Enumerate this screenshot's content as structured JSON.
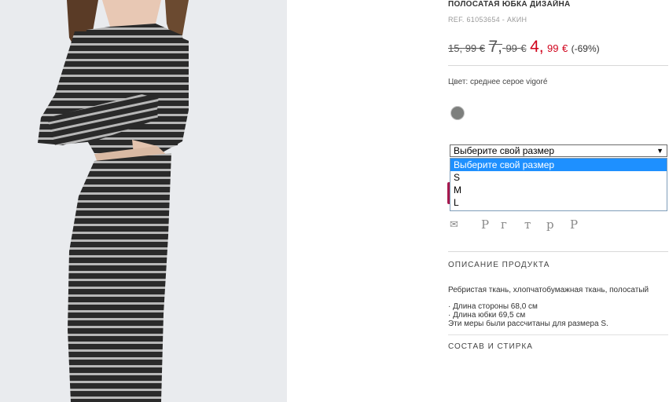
{
  "product": {
    "title": "ПОЛОСАТАЯ ЮБКА ДИЗАЙНА",
    "ref": "REF. 61053654 - АКИН",
    "price_old": {
      "int": "15,",
      "dec": "99",
      "cur": "€"
    },
    "price_mid": {
      "int": "7,",
      "dec": "99",
      "cur": "€"
    },
    "price_new": {
      "int": "4,",
      "dec": "99",
      "cur": "€"
    },
    "discount": "(-69%)",
    "color_label": "Цвет: среднее серое vigoré",
    "swatch_color": "#7d7f7d"
  },
  "size_select": {
    "selected": "Выберите свой размер",
    "options": [
      "Выберите свой размер",
      "S",
      "M",
      "L"
    ]
  },
  "share_icons": [
    "mail-icon",
    "pinterest-icon",
    "google-plus-icon",
    "twitter-icon",
    "polyvore-icon",
    "pinterest-alt-icon"
  ],
  "share_glyphs": [
    "✉",
    "P",
    "г",
    "т",
    "р",
    "P"
  ],
  "description": {
    "heading": "ОПИСАНИЕ ПРОДУКТА",
    "text": "Ребристая ткань, хлопчатобумажная ткань, полосатый",
    "bullets": [
      "· Длина стороны 68,0 см",
      "· Длина юбки 69,5 см"
    ],
    "note": "Эти меры были рассчитаны для размера S."
  },
  "composition": {
    "heading": "СОСТАВ И СТИРКА"
  }
}
